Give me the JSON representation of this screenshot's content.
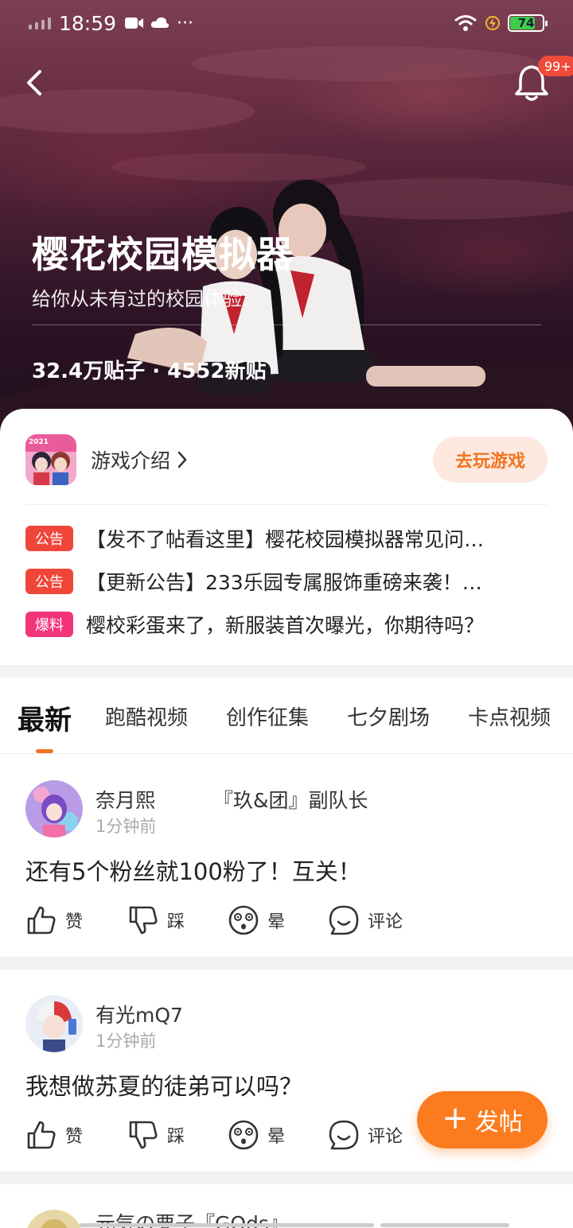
{
  "status_bar": {
    "time": "18:59",
    "battery": "74",
    "more": "···"
  },
  "header": {
    "notification_badge": "99+"
  },
  "hero": {
    "title": "樱花校园模拟器",
    "subtitle": "给你从未有过的校园体验",
    "stats": "32.4万贴子 · 4552新贴"
  },
  "game": {
    "icon_label": "2021",
    "intro_label": "游戏介绍",
    "play_label": "去玩游戏"
  },
  "notices": [
    {
      "tag": "公告",
      "text": "【发不了帖看这里】樱花校园模拟器常见问…"
    },
    {
      "tag": "公告",
      "text": "【更新公告】233乐园专属服饰重磅来袭！…"
    },
    {
      "tag": "爆料",
      "text": "樱校彩蛋来了，新服装首次曝光，你期待吗？"
    }
  ],
  "tabs": [
    "最新",
    "跑酷视频",
    "创作征集",
    "七夕剧场",
    "卡点视频"
  ],
  "posts": [
    {
      "author": "奈月熙",
      "title": "『玖&团』副队长",
      "time": "1分钟前",
      "text": "还有5个粉丝就100粉了！互关！"
    },
    {
      "author": "有光mQ7",
      "title": "",
      "time": "1分钟前",
      "text": "我想做苏夏的徒弟可以吗？"
    },
    {
      "author": "元気の栗子『GOds』"
    }
  ],
  "actions": {
    "like": "赞",
    "dislike": "踩",
    "dizzy": "晕",
    "comment": "评论"
  },
  "fab": {
    "label": "发帖"
  },
  "colors": {
    "accent": "#f27422",
    "notice_red": "#f0463a",
    "notice_pink": "#f2347a",
    "fab": "#fb7b1e"
  }
}
